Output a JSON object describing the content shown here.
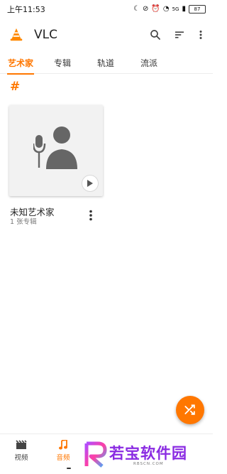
{
  "status": {
    "time": "上午11:53",
    "battery": "87",
    "network": "5G"
  },
  "app": {
    "title": "VLC",
    "actions": [
      "search-icon",
      "sort-icon",
      "more-vert-icon"
    ]
  },
  "tabs": [
    {
      "label": "艺术家",
      "active": true
    },
    {
      "label": "专辑",
      "active": false
    },
    {
      "label": "轨道",
      "active": false
    },
    {
      "label": "流派",
      "active": false
    }
  ],
  "section": {
    "letter": "#"
  },
  "artists": [
    {
      "name": "未知艺术家",
      "meta": "1 张专辑"
    }
  ],
  "bottom_nav": [
    {
      "label": "视频",
      "active": false,
      "icon": "video-icon"
    },
    {
      "label": "音频",
      "active": true,
      "icon": "music-note-icon"
    }
  ],
  "watermark": {
    "text": "若宝软件园",
    "sub": "RBSCN.COM"
  },
  "colors": {
    "accent": "#ff7700",
    "card_bg": "#f2f2f2"
  }
}
